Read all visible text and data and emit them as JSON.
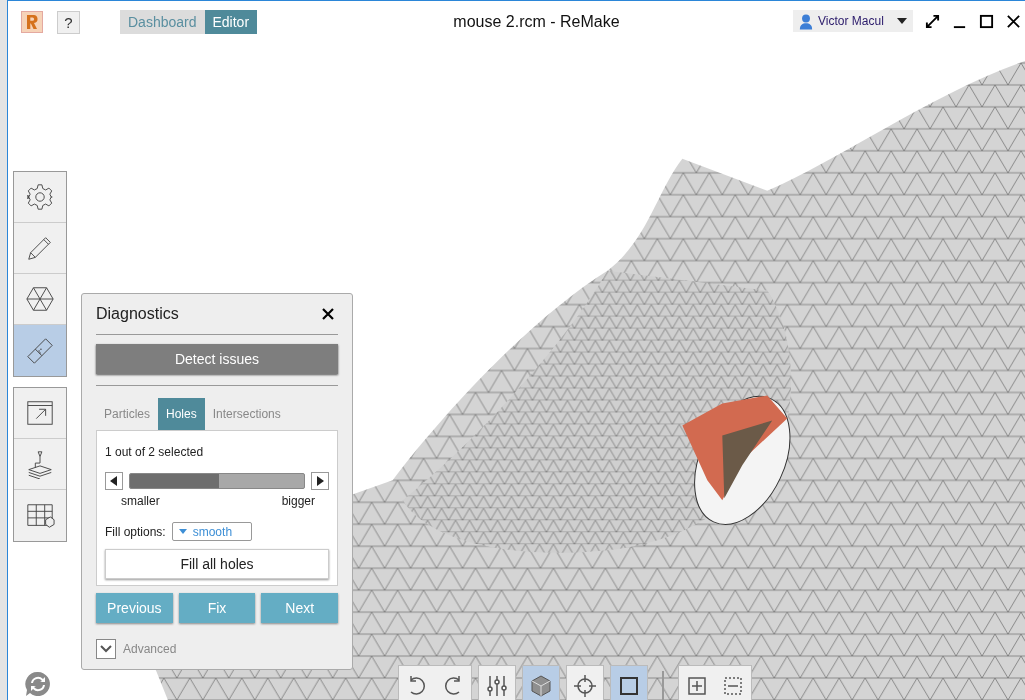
{
  "window": {
    "title": "mouse 2.rcm - ReMake"
  },
  "nav_tabs": [
    {
      "label": "Dashboard",
      "selected": false
    },
    {
      "label": "Editor",
      "selected": true
    }
  ],
  "help_button": {
    "label": "?"
  },
  "user": {
    "name": "Victor Macul"
  },
  "tool_groups": [
    {
      "tools": [
        {
          "kind": "settings",
          "selected": false
        },
        {
          "kind": "edit",
          "selected": false
        },
        {
          "kind": "mesh",
          "selected": false
        },
        {
          "kind": "diagnostics",
          "selected": true
        }
      ]
    },
    {
      "tools": [
        {
          "kind": "export",
          "selected": false
        },
        {
          "kind": "print",
          "selected": false
        },
        {
          "kind": "grid",
          "selected": false
        }
      ]
    }
  ],
  "diagnostics": {
    "title": "Diagnostics",
    "detect_button": "Detect issues",
    "tabs": [
      {
        "label": "Particles",
        "selected": false
      },
      {
        "label": "Holes",
        "selected": true
      },
      {
        "label": "Intersections",
        "selected": false
      }
    ],
    "selection_text": "1 out of 2 selected",
    "slider": {
      "level": 0.51,
      "min_label": "smaller",
      "max_label": "bigger"
    },
    "fill_options": {
      "label": "Fill options:",
      "value": "smooth"
    },
    "fill_all_button": "Fill all holes",
    "actions": [
      "Previous",
      "Fix",
      "Next"
    ],
    "advanced": {
      "label": "Advanced",
      "expanded": false
    }
  },
  "bottom_toolbar": [
    {
      "kind": "undo",
      "selected": false
    },
    {
      "kind": "redo",
      "selected": false
    },
    {
      "kind": "sliders",
      "selected": false
    },
    {
      "kind": "cube",
      "selected": true
    },
    {
      "kind": "target",
      "selected": false
    },
    {
      "kind": "square",
      "selected": true
    },
    {
      "kind": "add-box",
      "selected": false
    },
    {
      "kind": "remove-box",
      "selected": false
    }
  ]
}
